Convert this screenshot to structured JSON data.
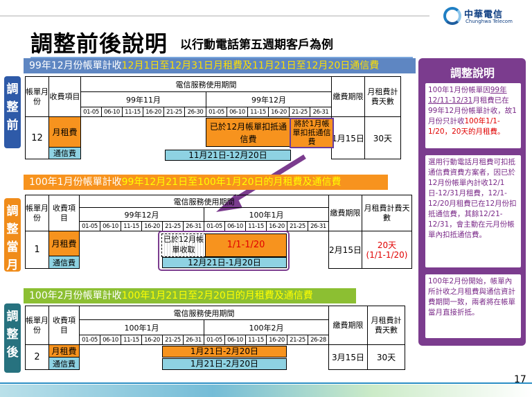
{
  "logo": {
    "name_cn": "中華電信",
    "name_en": "Chunghwa Telecom"
  },
  "title": "調整前後說明",
  "subtitle": "以行動電話第五週期客戶為例",
  "page_number": "17",
  "section1": {
    "side_label": [
      "調",
      "整",
      "前"
    ],
    "banner_pre": "99年12月份帳單計收",
    "banner_hl": "12月1日至12月31日月租費及11月21日至12月20日通信費",
    "headers": {
      "bill_month": "帳單月份",
      "item": "收費項目",
      "service_period": "電信服務使用期間",
      "due": "繳費期限",
      "days": "月租費計費天數"
    },
    "months": [
      "99年11月",
      "99年12月"
    ],
    "ranges": [
      "01-05",
      "06-10",
      "11-15",
      "16-20",
      "21-25",
      "26-30",
      "01-05",
      "06-10",
      "11-15",
      "16-20",
      "21-25",
      "26-31"
    ],
    "bill_month": "12",
    "items": [
      "月租費",
      "通信費"
    ],
    "bar_deducted": "已於12月帳單扣抵通信費",
    "bar_deduct_jan": "將於1月帳單扣抵通信費",
    "bar_comm": "11月21日-12月20日",
    "due": "1月15日",
    "days": "30天"
  },
  "section2": {
    "side_label": [
      "調",
      "整",
      "當",
      "月"
    ],
    "banner_pre": "100年1月份帳單計收",
    "banner_hl": "99年12月21日至100年1月20日的月租費及通信費",
    "headers": {
      "bill_month": "帳單月份",
      "item": "收費項目",
      "service_period": "電信服務使用期間",
      "due": "繳費期限",
      "days": "月租費計費天數"
    },
    "months": [
      "99年12月",
      "100年1月"
    ],
    "ranges": [
      "01-05",
      "06-10",
      "11-15",
      "16-20",
      "21-25",
      "26-31",
      "01-05",
      "06-10",
      "11-15",
      "16-20",
      "21-25",
      "26-31"
    ],
    "bill_month": "1",
    "items": [
      "月租費",
      "通信費"
    ],
    "bar_collected": "已於12月帳單收取",
    "bar_rent": "1/1-1/20",
    "bar_comm": "12月21日-1月20日",
    "due": "2月15日",
    "days": "20天",
    "days_range": "(1/1-1/20)"
  },
  "section3": {
    "side_label": [
      "調",
      "整",
      "後"
    ],
    "banner_pre": "100年2月份帳單計收",
    "banner_hl": "100年1月21日至2月20日的月租費及通信費",
    "headers": {
      "bill_month": "帳單月份",
      "item": "收費項目",
      "service_period": "電信服務使用期間",
      "due": "繳費期限",
      "days": "月租費計費天數"
    },
    "months": [
      "100年1月",
      "100年2月"
    ],
    "ranges": [
      "01-05",
      "06-10",
      "11-15",
      "16-20",
      "21-25",
      "26-31",
      "01-05",
      "06-10",
      "11-15",
      "16-20",
      "21-25",
      "26-28"
    ],
    "bill_month": "2",
    "items": [
      "月租費",
      "通信費"
    ],
    "bar_rent": "1月21日-2月20日",
    "bar_comm": "1月21日-2月20日",
    "due": "3月15日",
    "days": "30天"
  },
  "panel": {
    "title": "調整說明",
    "note1_a": "100年1月份帳單因",
    "note1_u": "99年12/11-12/31",
    "note1_b": "月租費已在99年12月份帳單計收，故1月份只計收",
    "note1_r": "100年1/1-1/20，20天的月租費。",
    "note2": "選用行動電話月租費可扣抵通信費資費方案者，因已於12月份帳單內計收12/1日-12/31月租費，12/1-12/20月租費已在12月份扣抵通信費，其餘12/21-12/31，會主動在元月份帳單內扣抵通信費。",
    "note3": "100年2月份開始，帳單內所計收之月租費與通信資計費期間一致，兩者將在帳單當月直接折抵。"
  }
}
